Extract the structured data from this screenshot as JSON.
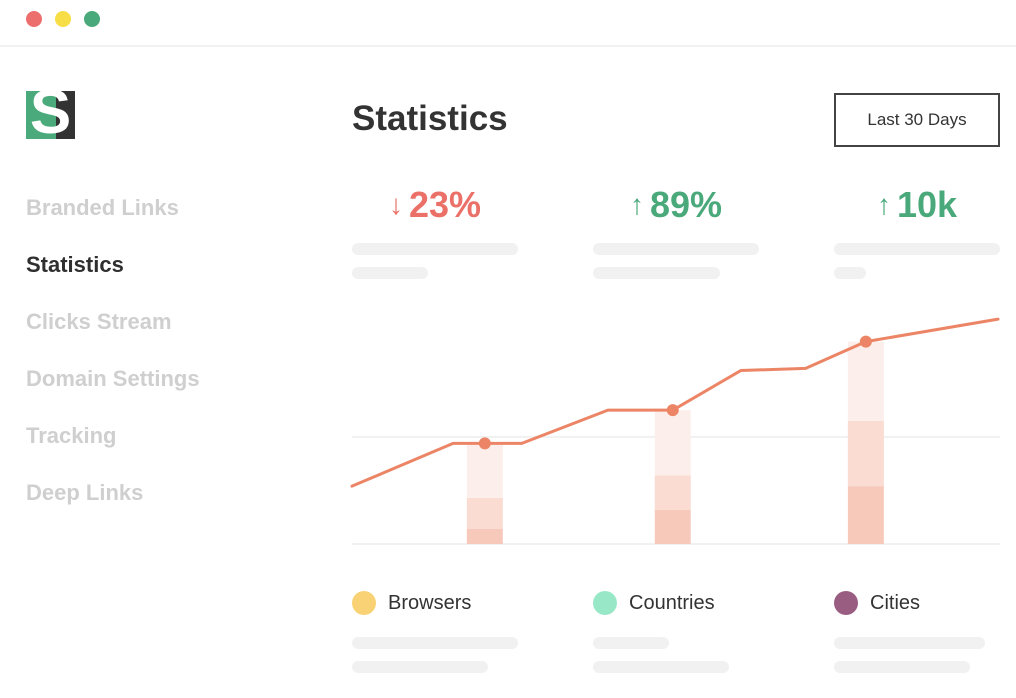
{
  "window": {
    "controls": [
      {
        "name": "close",
        "color": "#ec6f6e"
      },
      {
        "name": "minimize",
        "color": "#f7de47"
      },
      {
        "name": "maximize",
        "color": "#4aa97a"
      }
    ]
  },
  "logo": {
    "letter": "S",
    "colors": {
      "left": "#4aaa7b",
      "right": "#333333"
    }
  },
  "sidebar": {
    "items": [
      {
        "label": "Branded Links",
        "active": false
      },
      {
        "label": "Statistics",
        "active": true
      },
      {
        "label": "Clicks Stream",
        "active": false
      },
      {
        "label": "Domain Settings",
        "active": false
      },
      {
        "label": "Tracking",
        "active": false
      },
      {
        "label": "Deep Links",
        "active": false
      }
    ]
  },
  "header": {
    "title": "Statistics",
    "range_button": "Last 30 Days"
  },
  "stats": [
    {
      "arrow": "↓",
      "direction": "down",
      "value": "23%",
      "color": "#ea7068"
    },
    {
      "arrow": "↑",
      "direction": "up",
      "value": "89%",
      "color": "#4aa97a"
    },
    {
      "arrow": "↑",
      "direction": "up",
      "value": "10k",
      "color": "#4aa97a"
    }
  ],
  "legend": [
    {
      "label": "Browsers",
      "color": "#f8d274"
    },
    {
      "label": "Countries",
      "color": "#98e8c8"
    },
    {
      "label": "Cities",
      "color": "#9a5d82"
    }
  ],
  "chart_data": {
    "type": "line",
    "title": "",
    "xlabel": "",
    "ylabel": "",
    "grid": true,
    "gridlines_y": [
      0,
      50
    ],
    "ylim": [
      0,
      120
    ],
    "xlim": [
      0,
      100
    ],
    "line": {
      "color": "#ec8566",
      "x": [
        0,
        15.6,
        20.5,
        26.2,
        39.5,
        49.5,
        60,
        70,
        79.3,
        99.7
      ],
      "y": [
        27,
        47,
        47,
        47,
        62.5,
        62.5,
        81,
        82,
        94.5,
        105
      ]
    },
    "markers": [
      {
        "x": 20.5,
        "y": 47
      },
      {
        "x": 49.5,
        "y": 62.5
      },
      {
        "x": 79.3,
        "y": 94.5
      }
    ],
    "stacked_bars": {
      "x": [
        20.5,
        49.5,
        79.3
      ],
      "colors": [
        "#f7c9bb",
        "#fadcd3",
        "#fcefeb"
      ],
      "series": [
        {
          "name": "segment-1",
          "values": [
            7,
            16,
            27
          ]
        },
        {
          "name": "segment-2",
          "values": [
            14.5,
            16,
            30.5
          ]
        },
        {
          "name": "segment-3",
          "values": [
            25.5,
            30.5,
            37
          ]
        }
      ]
    }
  }
}
